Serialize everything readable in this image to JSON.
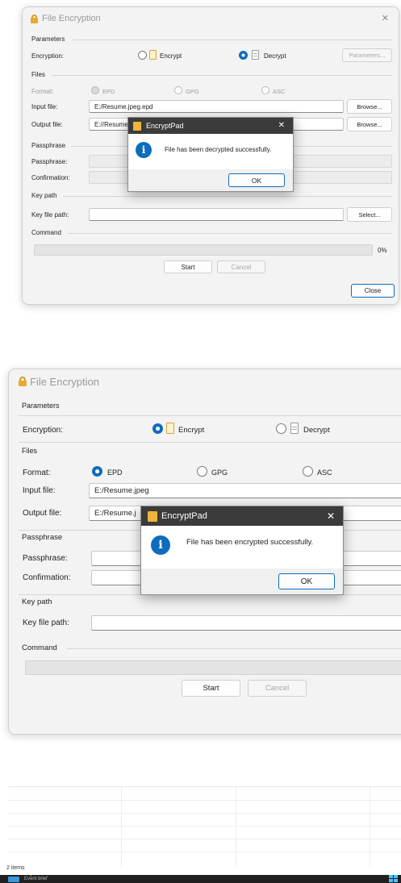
{
  "window1": {
    "title": "File Encryption",
    "groups": {
      "parameters": "Parameters",
      "files": "Files",
      "passphrase": "Passphrase",
      "key_path": "Key path",
      "command": "Command"
    },
    "encryption_label": "Encryption:",
    "encrypt_option": "Encrypt",
    "decrypt_option": "Decrypt",
    "selected_mode": "Decrypt",
    "parameters_button": "Parameters...",
    "format_label": "Format:",
    "formats": [
      "EPD",
      "GPG",
      "ASC"
    ],
    "input_label": "Input file:",
    "input_value": "E:/Resume.jpeg.epd",
    "output_label": "Output file:",
    "output_value": "E://Resume.",
    "browse_button": "Browse...",
    "passphrase_label": "Passphrase:",
    "confirmation_label": "Confirmation:",
    "key_file_label": "Key file path:",
    "select_button": "Select...",
    "progress_text": "0%",
    "progress_value": 0,
    "start_button": "Start",
    "cancel_button": "Cancel",
    "close_button": "Close",
    "close_glyph": "✕",
    "dialog": {
      "title": "EncryptPad",
      "message": "File has been decrypted successfully.",
      "ok": "OK",
      "close_glyph": "✕",
      "info_glyph": "i"
    }
  },
  "window2": {
    "title": "File Encryption",
    "groups": {
      "parameters": "Parameters",
      "files": "Files",
      "passphrase": "Passphrase",
      "key_path": "Key path",
      "command": "Command"
    },
    "encryption_label": "Encryption:",
    "encrypt_option": "Encrypt",
    "decrypt_option": "Decrypt",
    "selected_mode": "Encrypt",
    "format_label": "Format:",
    "formats": [
      "EPD",
      "GPG",
      "ASC"
    ],
    "selected_format": "EPD",
    "input_label": "Input file:",
    "input_value": "E:/Resume.jpeg",
    "output_label": "Output file:",
    "output_value": "E:/Resume.j",
    "passphrase_label": "Passphrase:",
    "confirmation_label": "Confirmation:",
    "key_file_label": "Key file path:",
    "start_button": "Start",
    "cancel_button": "Cancel",
    "dialog": {
      "title": "EncryptPad",
      "message": "File has been encrypted successfully.",
      "ok": "OK",
      "close_glyph": "✕",
      "info_glyph": "i"
    }
  },
  "explorer": {
    "status": "2 items"
  },
  "taskbar": {
    "widget_title": "Top events",
    "widget_subtitle": "Event brief",
    "accent": "#3a96dd",
    "background": "#202020"
  }
}
